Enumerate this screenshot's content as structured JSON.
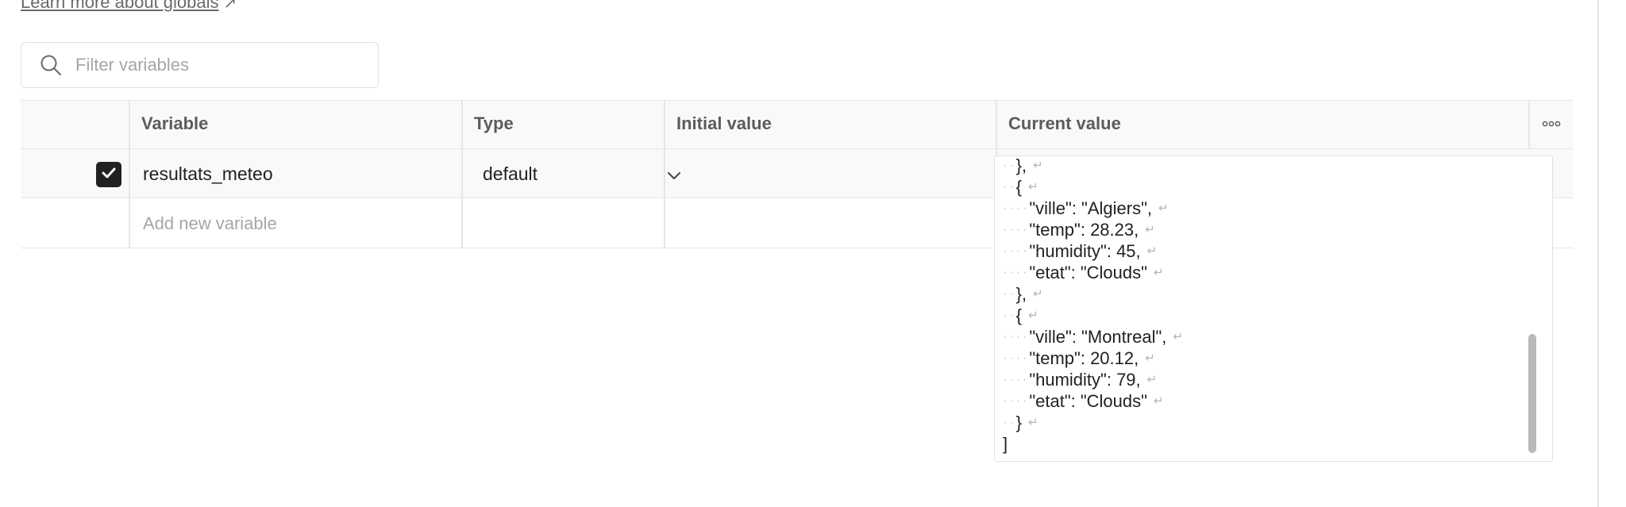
{
  "learn_link": {
    "label": "Learn more about globals",
    "arrow": "↗"
  },
  "filter": {
    "placeholder": "Filter variables",
    "icon": "search-icon"
  },
  "table": {
    "headers": {
      "variable": "Variable",
      "type": "Type",
      "initial_value": "Initial value",
      "current_value": "Current value"
    },
    "more_icon": "more-horizontal-icon",
    "rows": [
      {
        "checked": true,
        "variable": "resultats_meteo",
        "type": "default",
        "initial_value": ""
      }
    ],
    "add_new_placeholder": "Add new variable"
  },
  "editor": {
    "lines": [
      {
        "indent": 2,
        "text": "},"
      },
      {
        "indent": 2,
        "text": "{"
      },
      {
        "indent": 4,
        "text": "\"ville\": \"Algiers\","
      },
      {
        "indent": 4,
        "text": "\"temp\": 28.23,"
      },
      {
        "indent": 4,
        "text": "\"humidity\": 45,"
      },
      {
        "indent": 4,
        "text": "\"etat\": \"Clouds\""
      },
      {
        "indent": 2,
        "text": "},"
      },
      {
        "indent": 2,
        "text": "{"
      },
      {
        "indent": 4,
        "text": "\"ville\": \"Montreal\","
      },
      {
        "indent": 4,
        "text": "\"temp\": 20.12,"
      },
      {
        "indent": 4,
        "text": "\"humidity\": 79,"
      },
      {
        "indent": 4,
        "text": "\"etat\": \"Clouds\""
      },
      {
        "indent": 2,
        "text": "}"
      },
      {
        "indent": 0,
        "text": "]",
        "no_return": true
      }
    ],
    "whitespace_glyph": "·",
    "return_glyph": "↵"
  },
  "colors": {
    "checkbox": "#212121",
    "header_bg": "#f9f9f9",
    "border": "#e6e6e6"
  }
}
